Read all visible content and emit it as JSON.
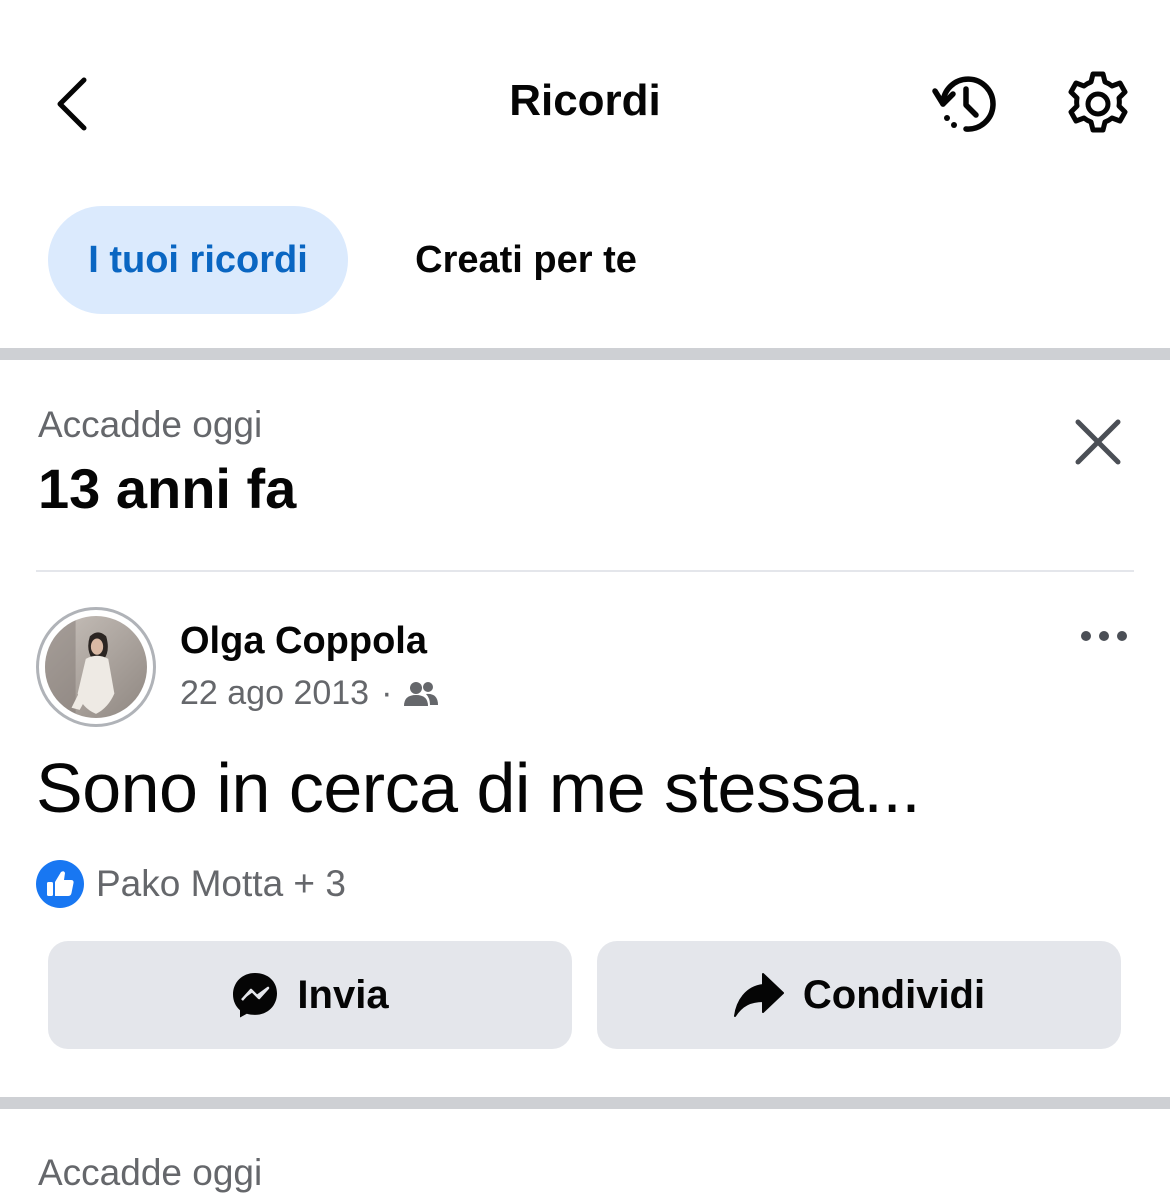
{
  "header": {
    "title": "Ricordi"
  },
  "tabs": [
    {
      "label": "I tuoi ricordi",
      "active": true
    },
    {
      "label": "Creati per te",
      "active": false
    }
  ],
  "memory": {
    "section_label": "Accadde oggi",
    "years_ago": "13 anni fa"
  },
  "post": {
    "author": "Olga Coppola",
    "date": "22 ago 2013",
    "separator": "·",
    "audience_icon": "friends-icon",
    "text": "Sono in cerca di me stessa...",
    "reactions_text": "Pako Motta + 3"
  },
  "actions": {
    "send_label": "Invia",
    "share_label": "Condividi"
  },
  "next_section_label": "Accadde oggi",
  "colors": {
    "accent": "#0a66c2",
    "tab_active_bg": "#dbeafd",
    "like_blue": "#1877f2",
    "button_bg": "#e4e6eb",
    "divider": "#ced0d4"
  }
}
